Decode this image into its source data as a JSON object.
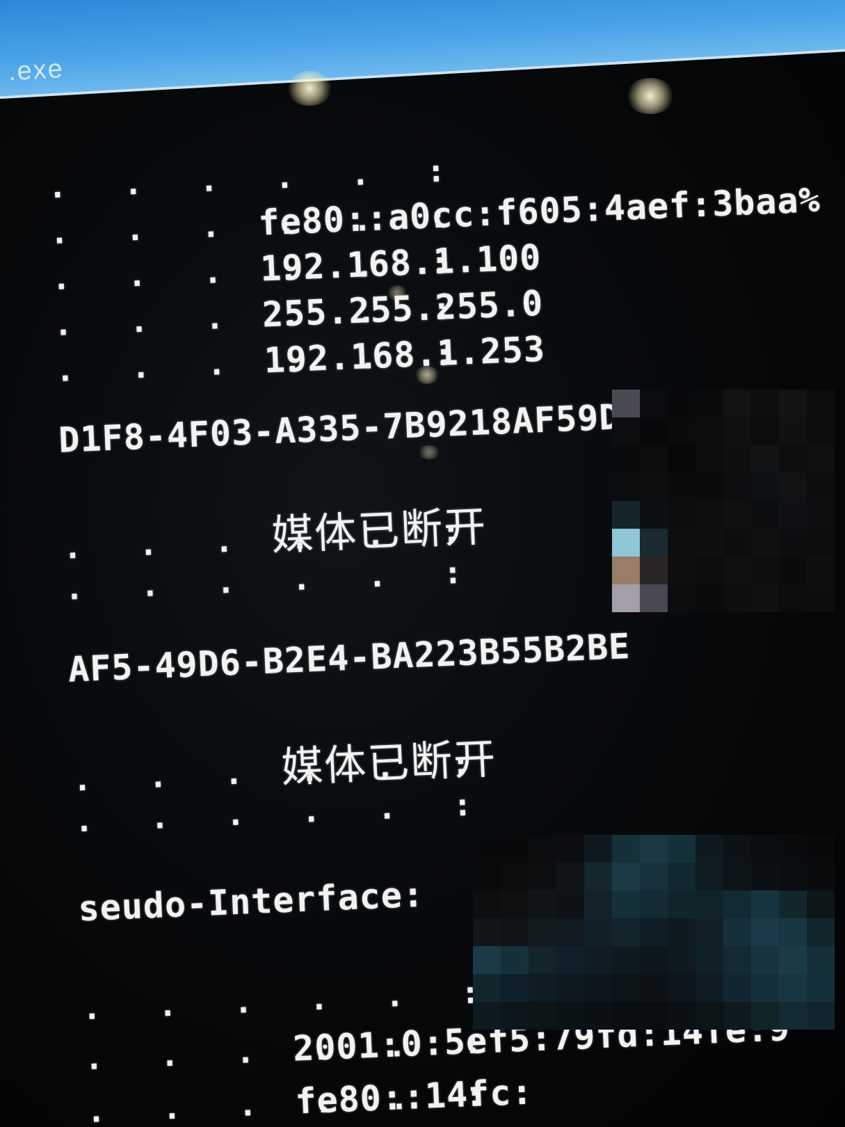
{
  "window": {
    "title": ".exe"
  },
  "console": {
    "lines": [
      {
        "dots": ". . . . . :",
        "value": ""
      },
      {
        "dots": ". . . . . :",
        "value": "fe80::a0cc:f605:4aef:3baa%"
      },
      {
        "dots": ". . . . . :",
        "value": "192.168.1.100"
      },
      {
        "dots": ". . . . . :",
        "value": "255.255.255.0"
      },
      {
        "dots": ". . . . . :",
        "value": "192.168.1.253"
      },
      {
        "text": "D1F8-4F03-A335-7B9218AF59D0>"
      },
      {
        "dots": ". . . . . :",
        "value": "媒体已断开"
      },
      {
        "dots": ". . . . . :",
        "value": ""
      },
      {
        "text": "AF5-49D6-B2E4-BA223B55B2BE"
      },
      {
        "dots": ". . . . . :",
        "value": "媒体已断开"
      },
      {
        "dots": ". . . . . :",
        "value": ""
      },
      {
        "text": "seudo-Interface:"
      },
      {
        "dots": ". . . . . :",
        "value": ""
      },
      {
        "dots": ". . . . . :",
        "value": "2001:0:5ef5:79fd:14fe:9"
      },
      {
        "dots": ". . . . . :",
        "value": "fe80::14fc:"
      }
    ]
  }
}
